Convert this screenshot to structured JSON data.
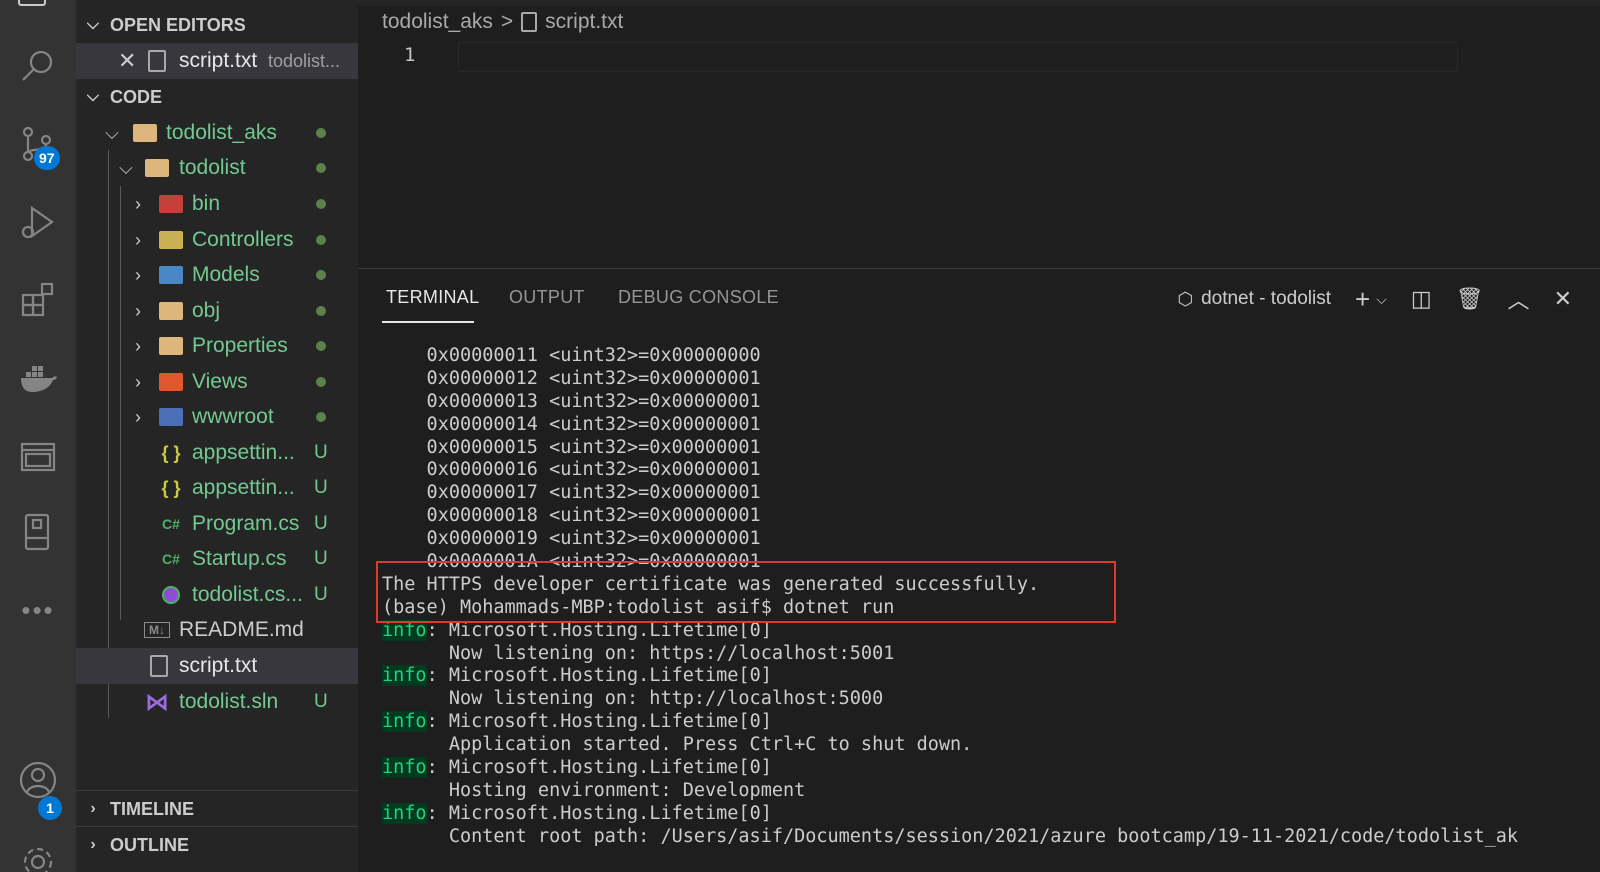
{
  "activity_bar": {
    "scm_badge": "97",
    "accounts_badge": "1",
    "icons": [
      "explorer-icon",
      "search-icon",
      "source-control-icon",
      "run-debug-icon",
      "extensions-icon",
      "docker-icon",
      "remote-explorer-icon",
      "device-icon",
      "more-icon",
      "accounts-icon",
      "settings-gear-icon"
    ]
  },
  "sidebar": {
    "open_editors_title": "OPEN EDITORS",
    "open_editor": {
      "name": "script.txt",
      "path": "todolist..."
    },
    "code_title": "CODE",
    "tree": [
      {
        "name": "todolist_aks",
        "status": "dot"
      },
      {
        "name": "todolist",
        "status": "dot"
      },
      {
        "name": "bin",
        "status": "dot"
      },
      {
        "name": "Controllers",
        "status": "dot"
      },
      {
        "name": "Models",
        "status": "dot"
      },
      {
        "name": "obj",
        "status": "dot"
      },
      {
        "name": "Properties",
        "status": "dot"
      },
      {
        "name": "Views",
        "status": "dot"
      },
      {
        "name": "wwwroot",
        "status": "dot"
      },
      {
        "name": "appsettin...",
        "status": "U"
      },
      {
        "name": "appsettin...",
        "status": "U"
      },
      {
        "name": "Program.cs",
        "status": "U"
      },
      {
        "name": "Startup.cs",
        "status": "U"
      },
      {
        "name": "todolist.cs...",
        "status": "U"
      },
      {
        "name": "README.md",
        "status": ""
      },
      {
        "name": "script.txt",
        "status": ""
      },
      {
        "name": "todolist.sln",
        "status": "U"
      }
    ],
    "timeline_title": "TIMELINE",
    "outline_title": "OUTLINE",
    "json_icon": "{ }",
    "cs_icon": "C#",
    "md_icon": "M↓"
  },
  "editor": {
    "breadcrumb_folder": "todolist_aks",
    "breadcrumb_sep": ">",
    "breadcrumb_file": "script.txt",
    "line_number": "1"
  },
  "panel": {
    "tabs": [
      "TERMINAL",
      "OUTPUT",
      "DEBUG CONSOLE"
    ],
    "terminal_name": "dotnet - todolist",
    "terminal_lines": [
      {
        "text": "    0x00000011 <uint32>=0x00000000"
      },
      {
        "text": "    0x00000012 <uint32>=0x00000001"
      },
      {
        "text": "    0x00000013 <uint32>=0x00000001"
      },
      {
        "text": "    0x00000014 <uint32>=0x00000001"
      },
      {
        "text": "    0x00000015 <uint32>=0x00000001"
      },
      {
        "text": "    0x00000016 <uint32>=0x00000001"
      },
      {
        "text": "    0x00000017 <uint32>=0x00000001"
      },
      {
        "text": "    0x00000018 <uint32>=0x00000001"
      },
      {
        "text": "    0x00000019 <uint32>=0x00000001"
      },
      {
        "text": "    0x0000001A <uint32>=0x00000001"
      },
      {
        "text": "The HTTPS developer certificate was generated successfully."
      },
      {
        "text": "(base) Mohammads-MBP:todolist asif$ dotnet run"
      },
      {
        "tag": "info",
        "text": ": Microsoft.Hosting.Lifetime[0]"
      },
      {
        "text": "      Now listening on: https://localhost:5001"
      },
      {
        "tag": "info",
        "text": ": Microsoft.Hosting.Lifetime[0]"
      },
      {
        "text": "      Now listening on: http://localhost:5000"
      },
      {
        "tag": "info",
        "text": ": Microsoft.Hosting.Lifetime[0]"
      },
      {
        "text": "      Application started. Press Ctrl+C to shut down."
      },
      {
        "tag": "info",
        "text": ": Microsoft.Hosting.Lifetime[0]"
      },
      {
        "text": "      Hosting environment: Development"
      },
      {
        "tag": "info",
        "text": ": Microsoft.Hosting.Lifetime[0]"
      },
      {
        "text": "      Content root path: /Users/asif/Documents/session/2021/azure bootcamp/19-11-2021/code/todolist_ak"
      }
    ]
  }
}
